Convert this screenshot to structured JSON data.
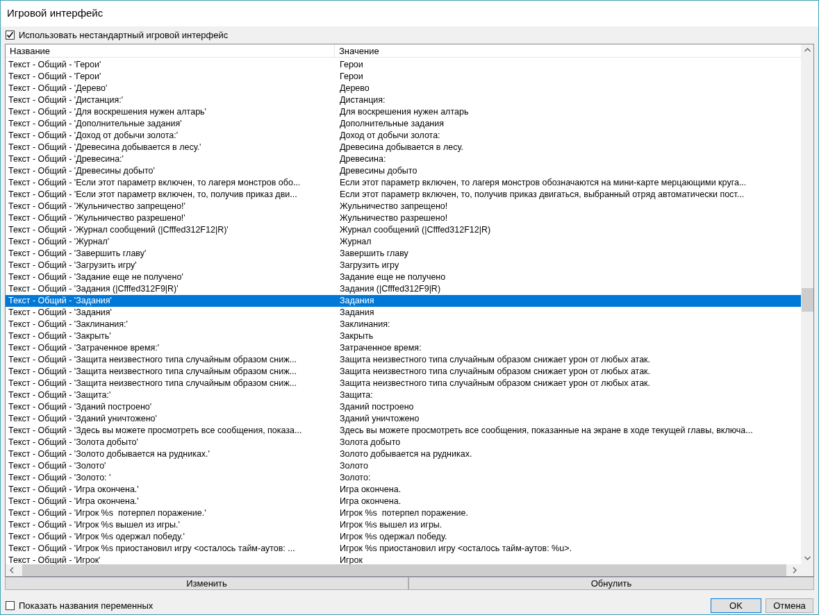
{
  "window": {
    "title": "Игровой интерфейс"
  },
  "use_custom_checkbox": {
    "label": "Использовать нестандартный игровой интерфейс",
    "checked": true
  },
  "table": {
    "columns": [
      "Название",
      "Значение"
    ],
    "rows": [
      {
        "name": "Текст - Общий - 'Герои'",
        "value": "Герои",
        "selected": false
      },
      {
        "name": "Текст - Общий - 'Герои'",
        "value": "Герои",
        "selected": false
      },
      {
        "name": "Текст - Общий - 'Дерево'",
        "value": "Дерево",
        "selected": false
      },
      {
        "name": "Текст - Общий - 'Дистанция:'",
        "value": "Дистанция:",
        "selected": false
      },
      {
        "name": "Текст - Общий - 'Для воскрешения нужен алтарь'",
        "value": "Для воскрешения нужен алтарь",
        "selected": false
      },
      {
        "name": "Текст - Общий - 'Дополнительные задания'",
        "value": "Дополнительные задания",
        "selected": false
      },
      {
        "name": "Текст - Общий - 'Доход от добычи золота:'",
        "value": "Доход от добычи золота:",
        "selected": false
      },
      {
        "name": "Текст - Общий - 'Древесина добывается в лесу.'",
        "value": "Древесина добывается в лесу.",
        "selected": false
      },
      {
        "name": "Текст - Общий - 'Древесина:'",
        "value": "Древесина:",
        "selected": false
      },
      {
        "name": "Текст - Общий - 'Древесины добыто'",
        "value": "Древесины добыто",
        "selected": false
      },
      {
        "name": "Текст - Общий - 'Если этот параметр включен, то лагеря монстров обо...",
        "value": "Если этот параметр включен, то лагеря монстров обозначаются на мини-карте мерцающими круга...",
        "selected": false
      },
      {
        "name": "Текст - Общий - 'Если этот параметр включен, то, получив приказ дви...",
        "value": "Если этот параметр включен, то, получив приказ двигаться, выбранный отряд автоматически пост...",
        "selected": false
      },
      {
        "name": "Текст - Общий - 'Жульничество запрещено!'",
        "value": "Жульничество запрещено!",
        "selected": false
      },
      {
        "name": "Текст - Общий - 'Жульничество разрешено!'",
        "value": "Жульничество разрешено!",
        "selected": false
      },
      {
        "name": "Текст - Общий - 'Журнал сообщений (|Cfffed312F12|R)'",
        "value": "Журнал сообщений (|Cfffed312F12|R)",
        "selected": false
      },
      {
        "name": "Текст - Общий - 'Журнал'",
        "value": "Журнал",
        "selected": false
      },
      {
        "name": "Текст - Общий - 'Завершить главу'",
        "value": "Завершить главу",
        "selected": false
      },
      {
        "name": "Текст - Общий - 'Загрузить игру'",
        "value": "Загрузить игру",
        "selected": false
      },
      {
        "name": "Текст - Общий - 'Задание еще не получено'",
        "value": "Задание еще не получено",
        "selected": false
      },
      {
        "name": "Текст - Общий - 'Задания (|Cfffed312F9|R)'",
        "value": "Задания (|Cfffed312F9|R)",
        "selected": false
      },
      {
        "name": "Текст - Общий - 'Задания'",
        "value": "Задания",
        "selected": true
      },
      {
        "name": "Текст - Общий - 'Задания'",
        "value": "Задания",
        "selected": false
      },
      {
        "name": "Текст - Общий - 'Заклинания:'",
        "value": "Заклинания:",
        "selected": false
      },
      {
        "name": "Текст - Общий - 'Закрыть'",
        "value": "Закрыть",
        "selected": false
      },
      {
        "name": "Текст - Общий - 'Затраченное время:'",
        "value": "Затраченное время:",
        "selected": false
      },
      {
        "name": "Текст - Общий - 'Защита неизвестного типа случайным образом сниж...",
        "value": "Защита неизвестного типа случайным образом снижает урон от любых атак.",
        "selected": false
      },
      {
        "name": "Текст - Общий - 'Защита неизвестного типа случайным образом сниж...",
        "value": "Защита неизвестного типа случайным образом снижает урон от любых атак.",
        "selected": false
      },
      {
        "name": "Текст - Общий - 'Защита неизвестного типа случайным образом сниж...",
        "value": "Защита неизвестного типа случайным образом снижает урон от любых атак.",
        "selected": false
      },
      {
        "name": "Текст - Общий - 'Защита:'",
        "value": "Защита:",
        "selected": false
      },
      {
        "name": "Текст - Общий - 'Зданий построено'",
        "value": "Зданий построено",
        "selected": false
      },
      {
        "name": "Текст - Общий - 'Зданий уничтожено'",
        "value": "Зданий уничтожено",
        "selected": false
      },
      {
        "name": "Текст - Общий - 'Здесь вы можете просмотреть все сообщения, показа...",
        "value": "Здесь вы можете просмотреть все сообщения, показанные на экране в ходе текущей главы, включа...",
        "selected": false
      },
      {
        "name": "Текст - Общий - 'Золота добыто'",
        "value": "Золота добыто",
        "selected": false
      },
      {
        "name": "Текст - Общий - 'Золото добывается на рудниках.'",
        "value": "Золото добывается на рудниках.",
        "selected": false
      },
      {
        "name": "Текст - Общий - 'Золото'",
        "value": "Золото",
        "selected": false
      },
      {
        "name": "Текст - Общий - 'Золото: '",
        "value": "Золото:",
        "selected": false
      },
      {
        "name": "Текст - Общий - 'Игра окончена.'",
        "value": "Игра окончена.",
        "selected": false
      },
      {
        "name": "Текст - Общий - 'Игра окончена.'",
        "value": "Игра окончена.",
        "selected": false
      },
      {
        "name": "Текст - Общий - 'Игрок %s  потерпел поражение.'",
        "value": "Игрок %s  потерпел поражение.",
        "selected": false
      },
      {
        "name": "Текст - Общий - 'Игрок %s вышел из игры.'",
        "value": "Игрок %s вышел из игры.",
        "selected": false
      },
      {
        "name": "Текст - Общий - 'Игрок %s одержал победу.'",
        "value": "Игрок %s одержал победу.",
        "selected": false
      },
      {
        "name": "Текст - Общий - 'Игрок %s приостановил игру <осталось тайм-аутов: ...",
        "value": "Игрок %s приостановил игру <осталось тайм-аутов: %u>.",
        "selected": false
      },
      {
        "name": "Текст - Общий - 'Игрок'",
        "value": "Игрок",
        "selected": false
      }
    ]
  },
  "action_buttons": [
    "Изменить",
    "Обнулить"
  ],
  "show_names_checkbox": {
    "label": "Показать названия переменных",
    "checked": false
  },
  "dialog_buttons": [
    "OK",
    "Отмена"
  ]
}
